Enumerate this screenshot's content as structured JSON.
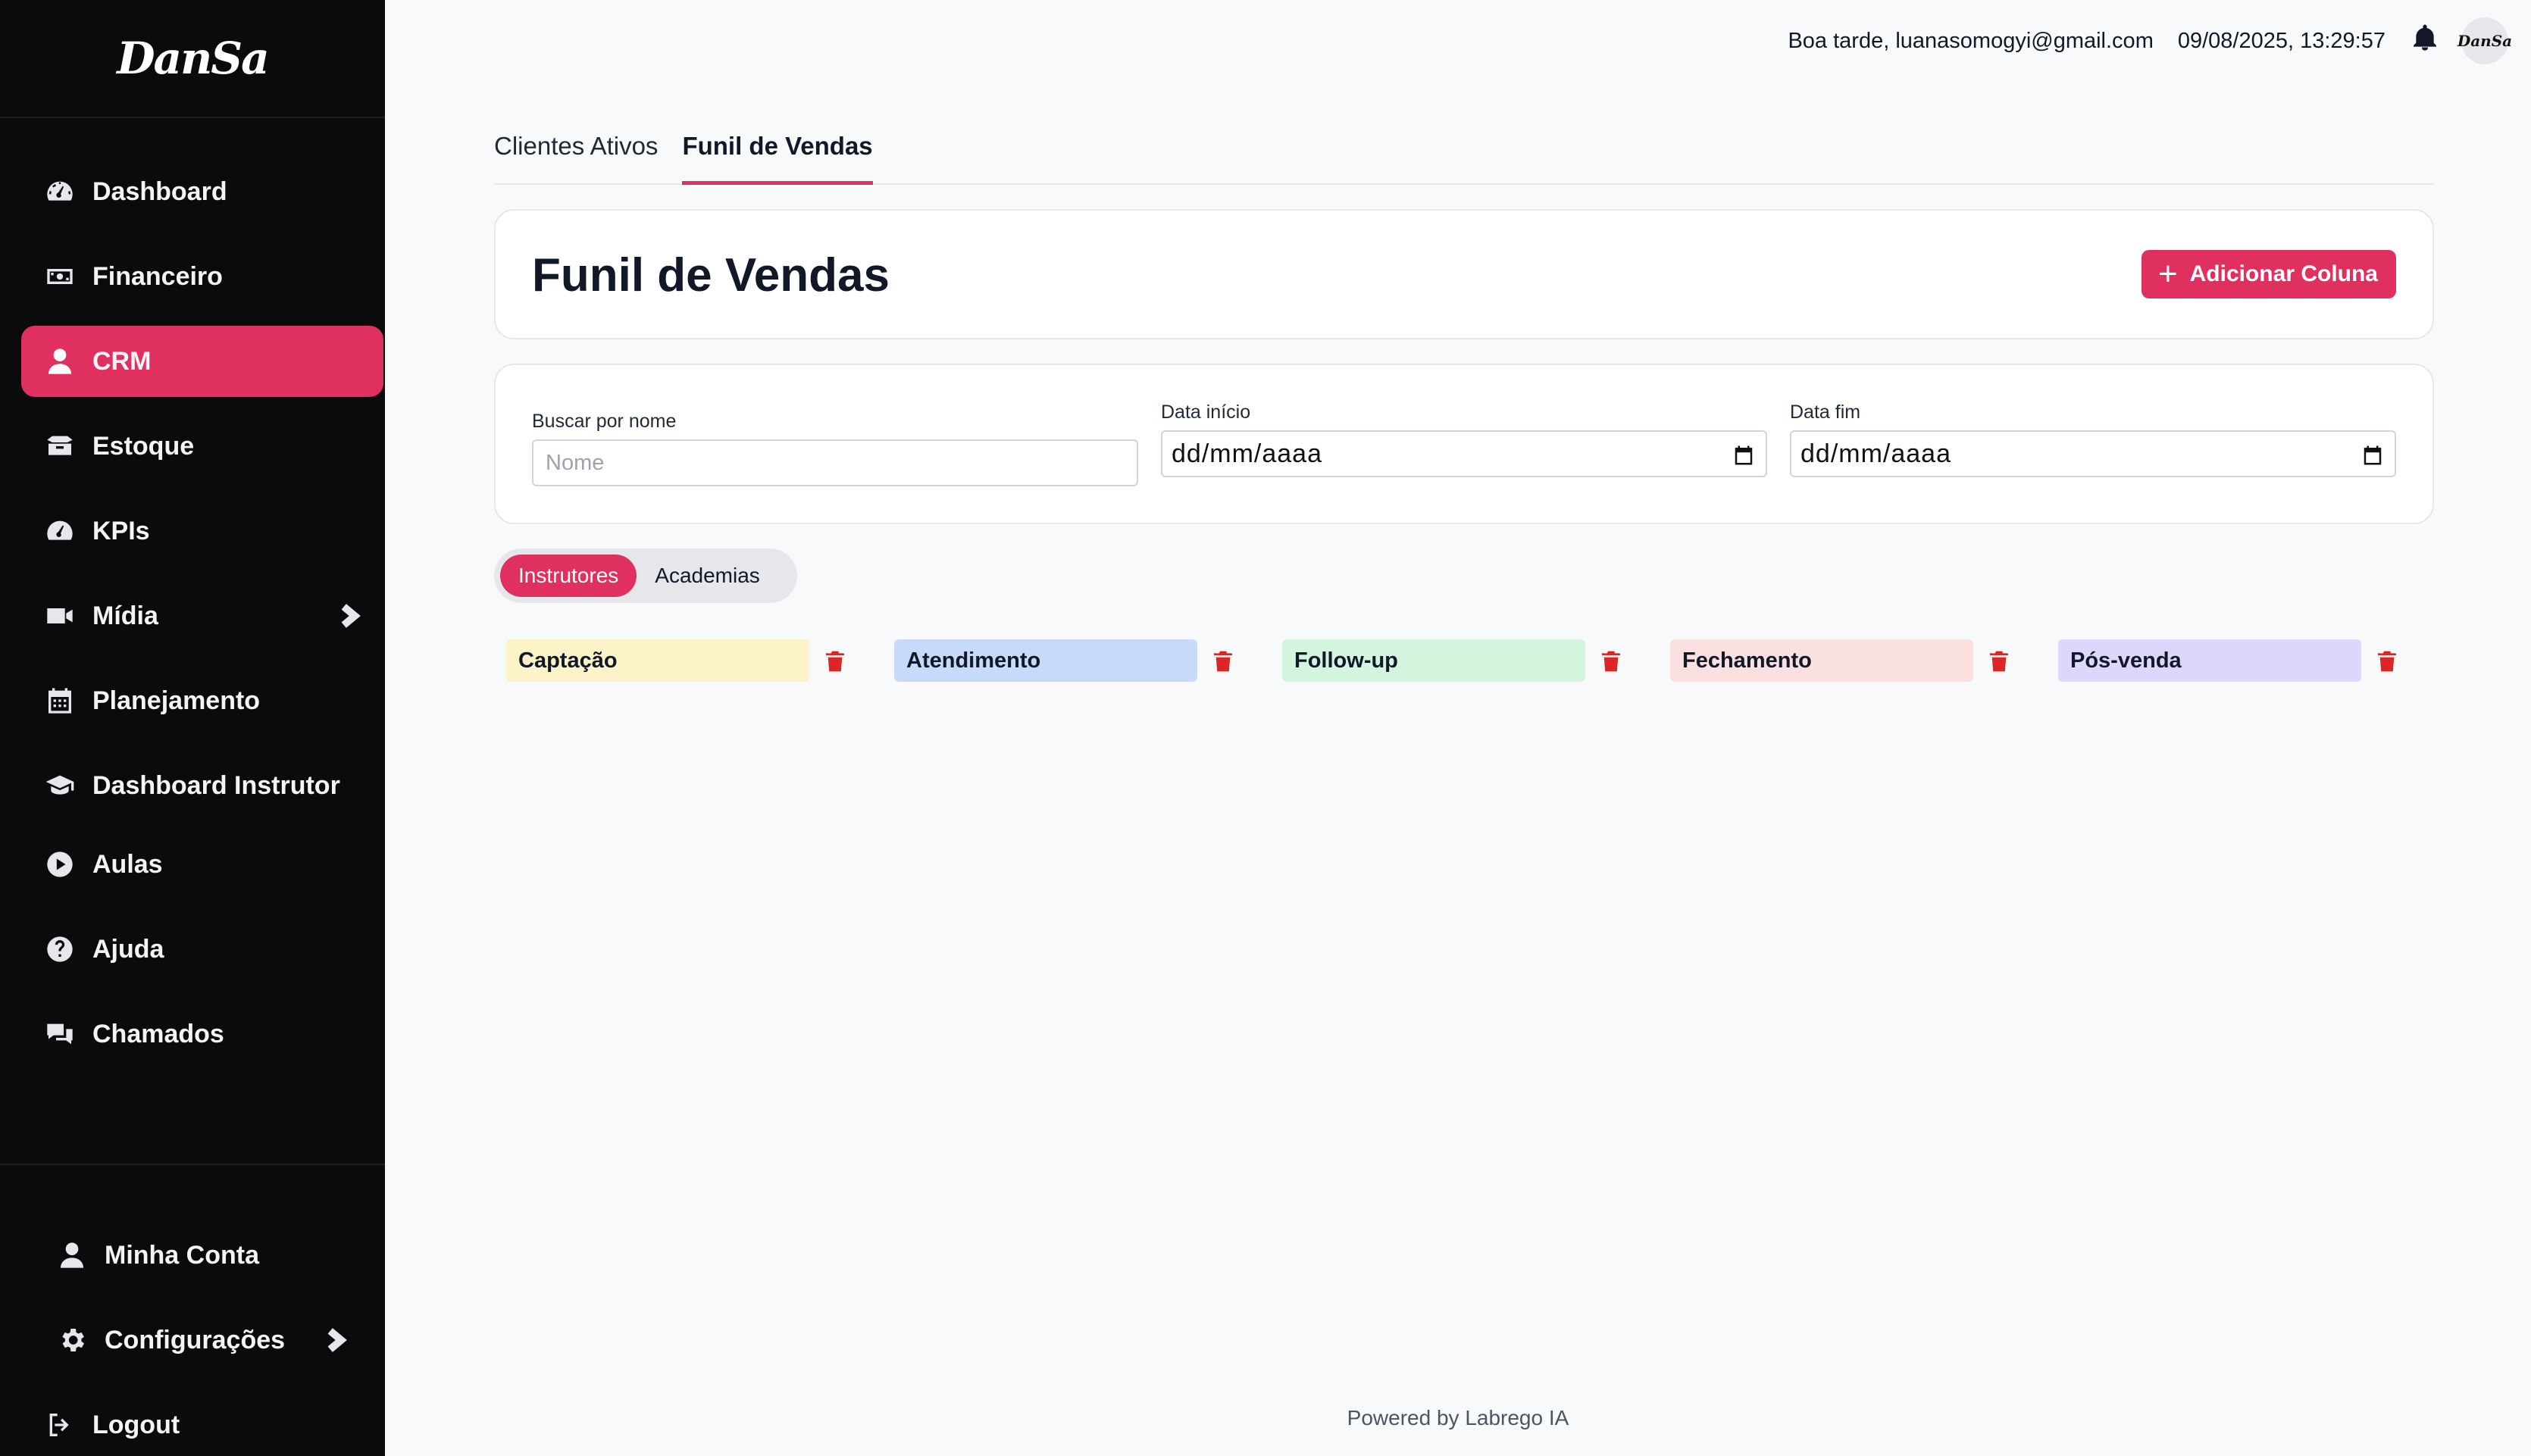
{
  "sidebar": {
    "logo": "DanSa",
    "items": [
      {
        "label": "Dashboard",
        "icon": "gauge-icon"
      },
      {
        "label": "Financeiro",
        "icon": "money-icon"
      },
      {
        "label": "CRM",
        "icon": "user-icon"
      },
      {
        "label": "Estoque",
        "icon": "box-icon"
      },
      {
        "label": "KPIs",
        "icon": "gauge-icon"
      },
      {
        "label": "Mídia",
        "icon": "video-icon"
      },
      {
        "label": "Planejamento",
        "icon": "calendar-icon"
      },
      {
        "label": "Dashboard Instrutor",
        "icon": "graduation-cap-icon"
      },
      {
        "label": "Aulas",
        "icon": "play-circle-icon"
      },
      {
        "label": "Ajuda",
        "icon": "question-circle-icon"
      },
      {
        "label": "Chamados",
        "icon": "chat-icon"
      }
    ],
    "active": "CRM",
    "bottom": [
      {
        "label": "Minha Conta",
        "icon": "user-icon"
      },
      {
        "label": "Configurações",
        "icon": "gear-icon"
      },
      {
        "label": "Logout",
        "icon": "logout-icon"
      }
    ]
  },
  "topbar": {
    "greeting": "Boa tarde, luanasomogyi@gmail.com",
    "datetime": "09/08/2025, 13:29:57",
    "avatar_text": "DanSa"
  },
  "tabs": [
    {
      "label": "Clientes Ativos",
      "active": false
    },
    {
      "label": "Funil de Vendas",
      "active": true
    }
  ],
  "header": {
    "title": "Funil de Vendas",
    "add_button": "Adicionar Coluna"
  },
  "filters": {
    "name_label": "Buscar por nome",
    "name_placeholder": "Nome",
    "start_label": "Data início",
    "start_value": "dd/mm/aaaa",
    "end_label": "Data fim",
    "end_value": "dd/mm/aaaa"
  },
  "segment": {
    "options": [
      "Instrutores",
      "Academias"
    ],
    "active": "Instrutores"
  },
  "columns": [
    {
      "label": "Captação",
      "color": "#fdf3c9"
    },
    {
      "label": "Atendimento",
      "color": "#c7dafa"
    },
    {
      "label": "Follow-up",
      "color": "#d3f5de"
    },
    {
      "label": "Fechamento",
      "color": "#fbe0e0"
    },
    {
      "label": "Pós-venda",
      "color": "#ddd8fb"
    }
  ],
  "footer": "Powered by Labrego IA",
  "colors": {
    "accent": "#e0305f",
    "sidebar_bg": "#0b0b0d",
    "trash": "#dc2626"
  }
}
